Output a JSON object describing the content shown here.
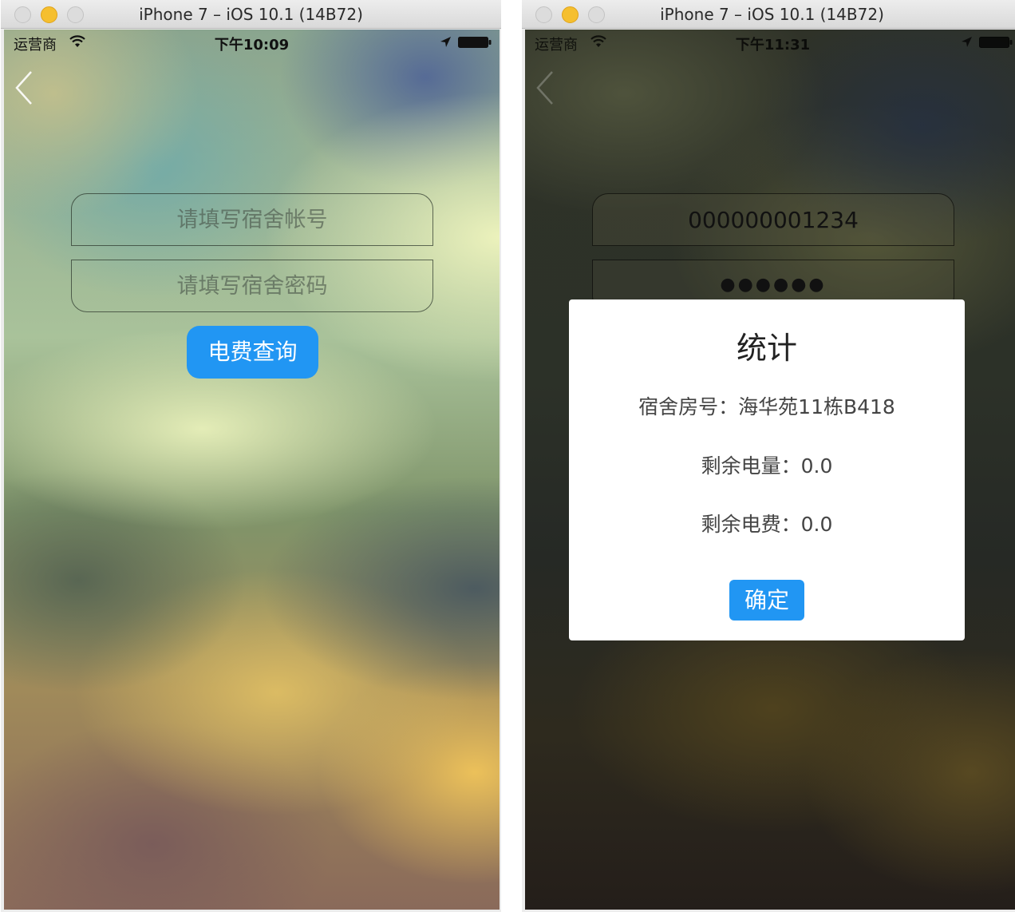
{
  "left_window": {
    "title": "iPhone 7 – iOS 10.1 (14B72)",
    "status": {
      "carrier": "运营商",
      "time": "下午10:09"
    },
    "account_field": {
      "value": "",
      "placeholder": "请填写宿舍帐号"
    },
    "password_field": {
      "value": "",
      "placeholder": "请填写宿舍密码"
    },
    "query_button_label": "电费查询"
  },
  "right_window": {
    "title": "iPhone 7 – iOS 10.1 (14B72)",
    "status": {
      "carrier": "运营商",
      "time": "下午11:31"
    },
    "account_value": "000000001234",
    "password_masked": "●●●●●●",
    "dialog": {
      "title": "统计",
      "room_line": "宿舍房号：海华苑11栋B418",
      "power_line": "剩余电量：0.0",
      "fee_line": "剩余电费：0.0",
      "ok_label": "确定"
    }
  },
  "icons": [
    "wifi-icon",
    "location-arrow-icon",
    "battery-icon",
    "back-chevron-icon"
  ],
  "colors": {
    "accent": "#2196f3",
    "dialog_bg": "#ffffff",
    "traffic_minimize": "#f5bf2f"
  }
}
